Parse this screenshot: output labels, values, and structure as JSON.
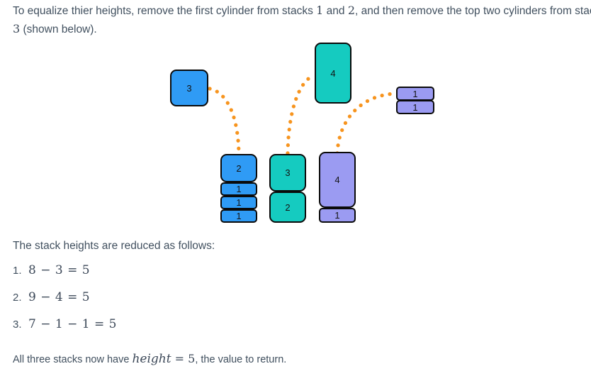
{
  "intro": {
    "part1": "To equalize thier heights, remove the first cylinder from stacks ",
    "n1": "1",
    "part2": " and ",
    "n2": "2",
    "part3": ", and then remove the top two cylinders from stack ",
    "n3": "3",
    "part4": " (shown below)."
  },
  "reduced_heading": "The stack heights are reduced as follows:",
  "equations": [
    {
      "num": "1.",
      "text": "8 − 3 = 5"
    },
    {
      "num": "2.",
      "text": "9 − 4 = 5"
    },
    {
      "num": "3.",
      "text": "7 − 1 − 1 = 5"
    }
  ],
  "conclusion": {
    "part1": "All three stacks now have ",
    "var": "height",
    "eq": " = ",
    "value": "5",
    "part2": ", the value to return."
  },
  "colors": {
    "blue": "#2f9bf5",
    "teal": "#15cbc0",
    "purple": "#9b9bf2",
    "outline": "#0a0a0a",
    "arrow": "#f7941e",
    "text": "#41505f"
  },
  "diagram": {
    "removed": [
      {
        "name": "removed-stack1-cylinder",
        "label": "3",
        "color": "blue"
      },
      {
        "name": "removed-stack2-cylinder",
        "label": "4",
        "color": "teal"
      },
      {
        "name": "removed-stack3-cylinder-top",
        "label": "1",
        "color": "purple"
      },
      {
        "name": "removed-stack3-cylinder-second",
        "label": "1",
        "color": "purple"
      }
    ],
    "stacks": [
      {
        "name": "stack-1",
        "color": "blue",
        "cylinders": [
          {
            "label": "2"
          },
          {
            "label": "1"
          },
          {
            "label": "1"
          },
          {
            "label": "1"
          }
        ]
      },
      {
        "name": "stack-2",
        "color": "teal",
        "cylinders": [
          {
            "label": "3"
          },
          {
            "label": "2"
          }
        ]
      },
      {
        "name": "stack-3",
        "color": "purple",
        "cylinders": [
          {
            "label": "4"
          },
          {
            "label": "1"
          }
        ]
      }
    ]
  }
}
